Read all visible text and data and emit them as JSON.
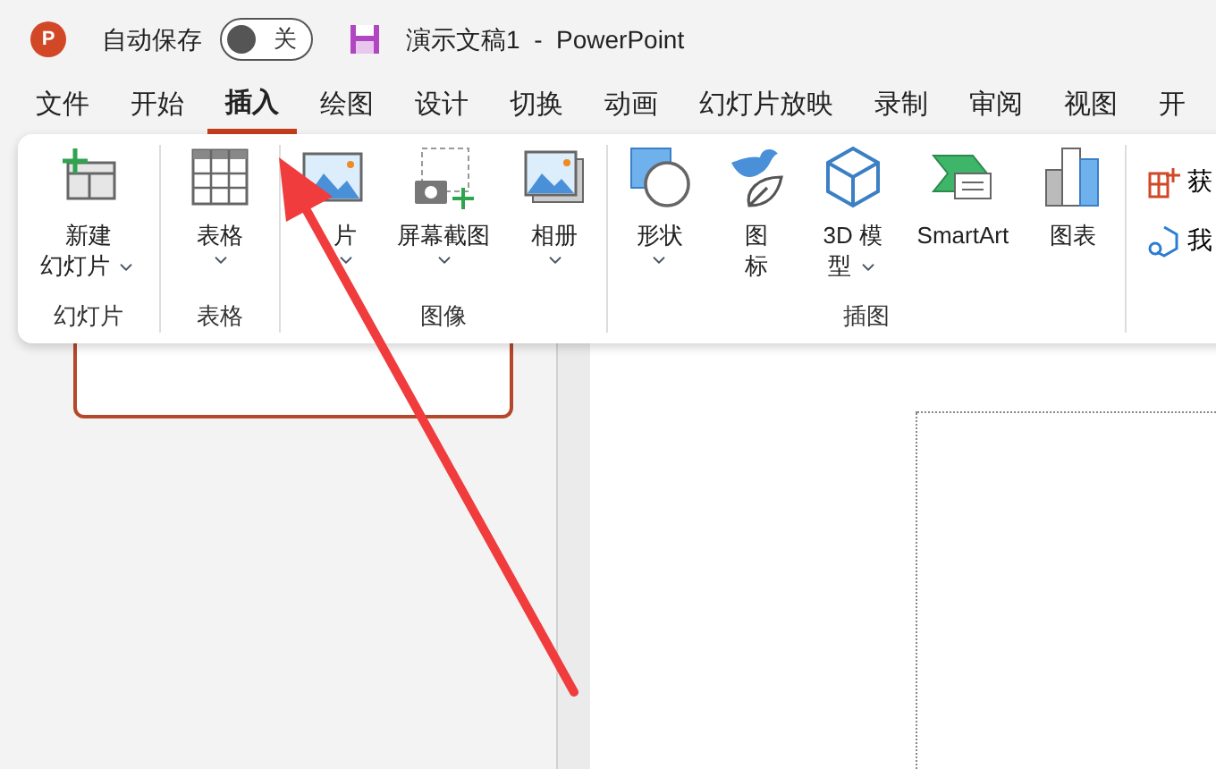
{
  "title_bar": {
    "app_logo": "P",
    "autosave_label": "自动保存",
    "autosave": {
      "on": false,
      "label": "关"
    },
    "document_title": "演示文稿1  -  PowerPoint"
  },
  "tabs": [
    {
      "label": "文件",
      "selected": false
    },
    {
      "label": "开始",
      "selected": false
    },
    {
      "label": "插入",
      "selected": true
    },
    {
      "label": "绘图",
      "selected": false
    },
    {
      "label": "设计",
      "selected": false
    },
    {
      "label": "切换",
      "selected": false
    },
    {
      "label": "动画",
      "selected": false
    },
    {
      "label": "幻灯片放映",
      "selected": false
    },
    {
      "label": "录制",
      "selected": false
    },
    {
      "label": "审阅",
      "selected": false
    },
    {
      "label": "视图",
      "selected": false
    },
    {
      "label": "开",
      "selected": false
    }
  ],
  "ribbon": {
    "groups": [
      {
        "label": "幻灯片",
        "buttons": [
          {
            "lines": [
              "新建",
              "幻灯片"
            ],
            "dropdown": true,
            "chevron_beside_label": true
          }
        ]
      },
      {
        "label": "表格",
        "buttons": [
          {
            "lines": [
              "表格"
            ],
            "dropdown": true,
            "chevron_beside_label": false
          }
        ]
      },
      {
        "label": "图像",
        "buttons": [
          {
            "lines": [
              "片"
            ],
            "dropdown": true,
            "chevron_beside_label": false
          },
          {
            "lines": [
              "屏幕截图"
            ],
            "dropdown": true,
            "chevron_beside_label": false
          },
          {
            "lines": [
              "相册"
            ],
            "dropdown": true,
            "chevron_beside_label": false
          }
        ]
      },
      {
        "label": "插图",
        "buttons": [
          {
            "lines": [
              "形状"
            ],
            "dropdown": true,
            "chevron_beside_label": false
          },
          {
            "lines": [
              "图",
              "标"
            ],
            "dropdown": false
          },
          {
            "lines": [
              "3D 模",
              "型"
            ],
            "dropdown": true,
            "chevron_beside_label": true
          },
          {
            "lines": [
              "SmartArt"
            ],
            "dropdown": false
          },
          {
            "lines": [
              "图表"
            ],
            "dropdown": false
          }
        ]
      }
    ],
    "side_items": [
      {
        "label": "获"
      },
      {
        "label": "我"
      }
    ]
  }
}
